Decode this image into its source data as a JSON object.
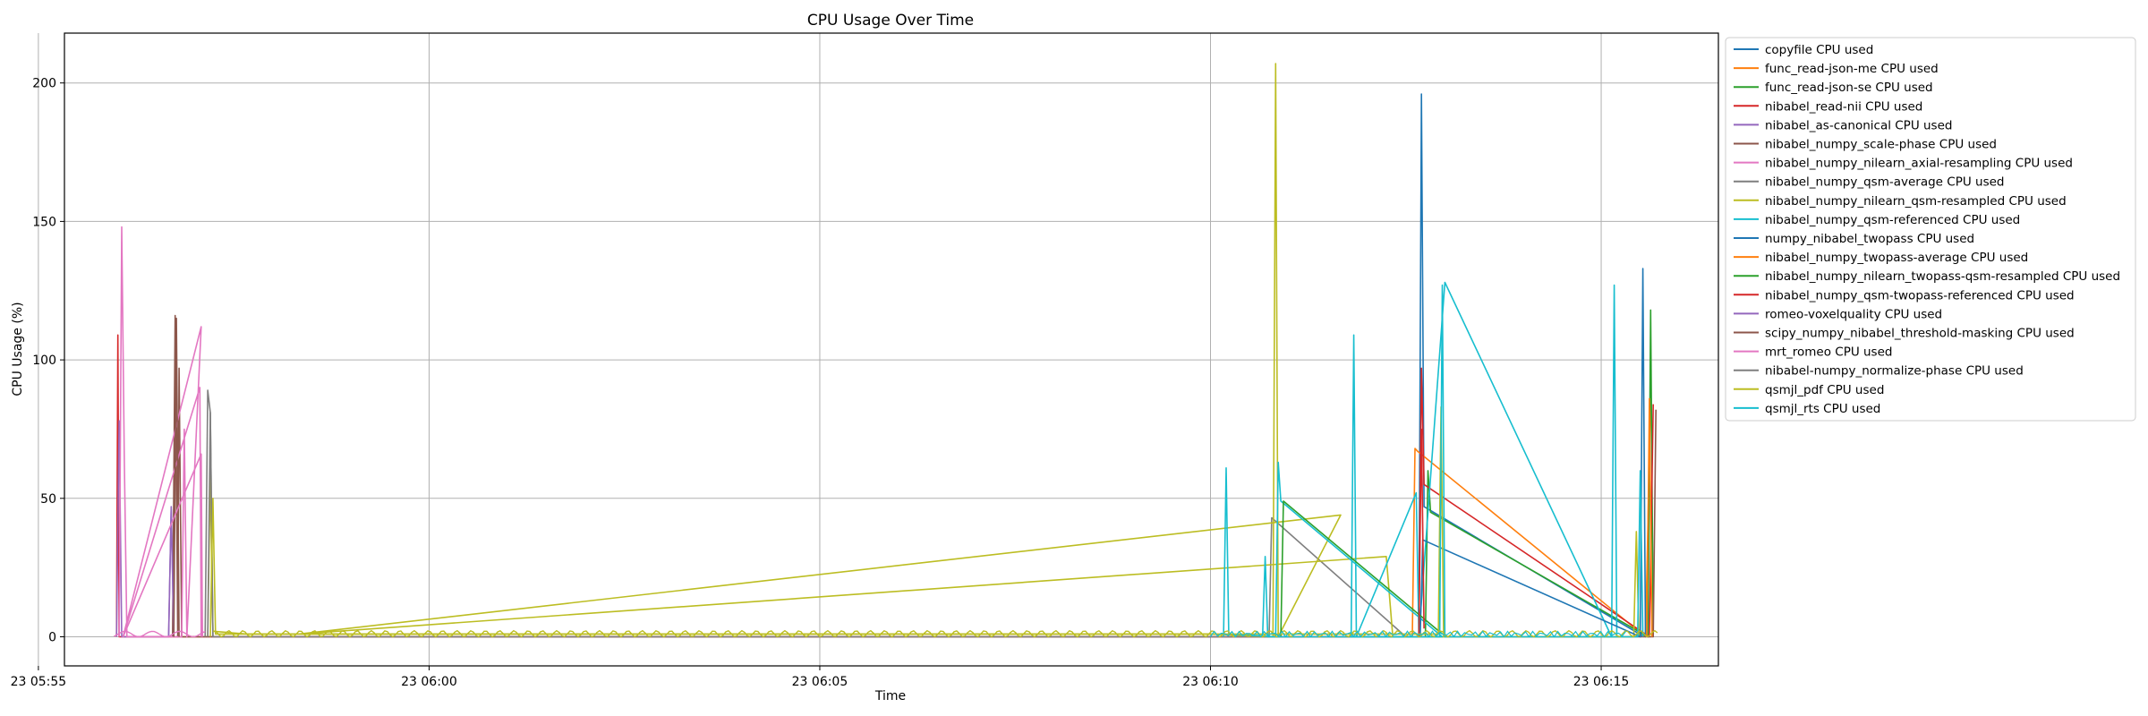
{
  "chart_data": {
    "type": "line",
    "title": "CPU Usage Over Time",
    "xlabel": "Time",
    "ylabel": "CPU Usage (%)",
    "grid": true,
    "legend_placement": "outside-right",
    "x_ticks": [
      "23 05:55",
      "23 06:00",
      "23 06:05",
      "23 06:10",
      "23 06:15"
    ],
    "y_ticks": [
      0,
      50,
      100,
      150,
      200
    ],
    "xlim": [
      "05:55:20",
      "06:16:30"
    ],
    "ylim": [
      -10.5,
      218
    ],
    "series": [
      {
        "name": "copyfile CPU used",
        "color": "#1f77b4",
        "points": [
          [
            "06:12:40",
            0
          ],
          [
            "06:12:42",
            196
          ],
          [
            "06:12:44",
            47
          ],
          [
            "06:15:33",
            0
          ]
        ]
      },
      {
        "name": "func_read-json-me CPU used",
        "color": "#ff7f0e",
        "points": [
          [
            "06:12:35",
            0
          ],
          [
            "06:12:37",
            68
          ],
          [
            "06:12:39",
            67
          ],
          [
            "06:15:34",
            0
          ],
          [
            "06:15:38",
            85
          ]
        ]
      },
      {
        "name": "func_read-json-se CPU used",
        "color": "#2ca02c",
        "points": [
          [
            "06:12:45",
            0
          ],
          [
            "06:12:47",
            60
          ],
          [
            "06:12:49",
            45
          ],
          [
            "06:15:36",
            0
          ],
          [
            "06:15:38",
            118
          ],
          [
            "06:15:40",
            0
          ]
        ]
      },
      {
        "name": "nibabel_read-nii CPU used",
        "color": "#d62728",
        "points": [
          [
            "05:56:00",
            0
          ],
          [
            "05:56:01",
            109
          ],
          [
            "05:56:02",
            0
          ],
          [
            "06:12:40",
            0
          ],
          [
            "06:12:42",
            97
          ],
          [
            "06:12:44",
            55
          ],
          [
            "06:15:37",
            0
          ],
          [
            "06:15:40",
            84
          ]
        ]
      },
      {
        "name": "nibabel_as-canonical CPU used",
        "color": "#9467bd",
        "points": [
          [
            "05:56:00",
            0
          ],
          [
            "05:56:02",
            78
          ],
          [
            "05:56:04",
            0
          ],
          [
            "05:56:40",
            0
          ],
          [
            "05:56:42",
            47
          ],
          [
            "05:56:44",
            0
          ]
        ]
      },
      {
        "name": "nibabel_numpy_scale-phase CPU used",
        "color": "#8c564b",
        "points": [
          [
            "05:56:43",
            0
          ],
          [
            "05:56:45",
            116
          ],
          [
            "05:56:47",
            0
          ],
          [
            "05:56:48",
            97
          ],
          [
            "05:56:50",
            0
          ],
          [
            "06:15:40",
            0
          ],
          [
            "06:15:42",
            82
          ]
        ]
      },
      {
        "name": "nibabel_numpy_nilearn_axial-resampling CPU used",
        "color": "#e377c2",
        "points": [
          [
            "05:56:02",
            0
          ],
          [
            "05:56:04",
            148
          ],
          [
            "05:56:06",
            64
          ],
          [
            "05:56:08",
            0
          ],
          [
            "05:56:50",
            0
          ],
          [
            "05:56:52",
            75
          ],
          [
            "05:56:54",
            0
          ],
          [
            "05:57:05",
            112
          ],
          [
            "05:56:05",
            0
          ],
          [
            "05:57:04",
            90
          ],
          [
            "05:57:05",
            0
          ]
        ]
      },
      {
        "name": "nibabel_numpy_qsm-average CPU used",
        "color": "#7f7f7f",
        "points": [
          [
            "05:57:08",
            0
          ],
          [
            "05:57:10",
            89
          ],
          [
            "05:57:12",
            81
          ],
          [
            "05:57:14",
            0
          ],
          [
            "06:10:45",
            0
          ],
          [
            "06:10:47",
            43
          ],
          [
            "06:12:30",
            0
          ]
        ]
      },
      {
        "name": "nibabel_numpy_nilearn_qsm-resampled CPU used",
        "color": "#bcbd22",
        "points": [
          [
            "05:57:10",
            0
          ],
          [
            "05:57:12",
            58
          ],
          [
            "05:57:14",
            2
          ],
          [
            "05:57:40",
            1
          ],
          [
            "06:00:00",
            1
          ],
          [
            "06:05:00",
            1
          ],
          [
            "06:10:00",
            1
          ],
          [
            "06:10:48",
            0
          ],
          [
            "06:10:50",
            207
          ],
          [
            "06:10:52",
            0
          ],
          [
            "06:11:40",
            44
          ],
          [
            "05:58:20",
            1
          ],
          [
            "06:12:15",
            29
          ],
          [
            "06:12:20",
            0
          ],
          [
            "06:15:25",
            0
          ],
          [
            "06:15:27",
            38
          ],
          [
            "06:15:29",
            0
          ]
        ]
      },
      {
        "name": "nibabel_numpy_qsm-referenced CPU used",
        "color": "#17becf",
        "points": [
          [
            "06:10:10",
            0
          ],
          [
            "06:10:12",
            61
          ],
          [
            "06:10:14",
            1
          ],
          [
            "06:10:50",
            0
          ],
          [
            "06:10:52",
            63
          ],
          [
            "06:10:54",
            49
          ],
          [
            "06:12:58",
            0
          ],
          [
            "06:11:48",
            0
          ],
          [
            "06:11:50",
            109
          ],
          [
            "06:11:52",
            0
          ],
          [
            "06:12:38",
            52
          ],
          [
            "06:12:40",
            0
          ],
          [
            "06:13:00",
            128
          ],
          [
            "06:15:08",
            0
          ],
          [
            "06:15:10",
            127
          ],
          [
            "06:15:12",
            0
          ]
        ]
      },
      {
        "name": "numpy_nibabel_twopass CPU used",
        "color": "#1f77b4",
        "points": [
          [
            "06:12:41",
            0
          ],
          [
            "06:12:43",
            35
          ],
          [
            "06:15:30",
            0
          ],
          [
            "06:15:32",
            133
          ],
          [
            "06:15:34",
            0
          ]
        ]
      },
      {
        "name": "nibabel_numpy_twopass-average CPU used",
        "color": "#ff7f0e",
        "points": [
          [
            "06:15:35",
            0
          ],
          [
            "06:15:37",
            86
          ],
          [
            "06:15:39",
            0
          ]
        ]
      },
      {
        "name": "nibabel_numpy_nilearn_twopass-qsm-resampled CPU used",
        "color": "#2ca02c",
        "points": [
          [
            "06:10:54",
            0
          ],
          [
            "06:10:56",
            49
          ],
          [
            "06:12:58",
            1
          ]
        ]
      },
      {
        "name": "nibabel_numpy_qsm-twopass-referenced CPU used",
        "color": "#d62728",
        "points": [
          [
            "06:12:40",
            0
          ],
          [
            "06:12:42",
            75
          ],
          [
            "06:12:44",
            3
          ]
        ]
      },
      {
        "name": "romeo-voxelquality CPU used",
        "color": "#9467bd",
        "points": [
          [
            "05:56:40",
            0
          ],
          [
            "05:56:42",
            46
          ],
          [
            "05:56:44",
            0
          ]
        ]
      },
      {
        "name": "scipy_numpy_nibabel_threshold-masking CPU used",
        "color": "#8c564b",
        "points": [
          [
            "05:56:44",
            0
          ],
          [
            "05:56:46",
            115
          ],
          [
            "05:56:48",
            0
          ]
        ]
      },
      {
        "name": "mrt_romeo CPU used",
        "color": "#e377c2",
        "points": [
          [
            "05:56:05",
            0
          ],
          [
            "05:57:05",
            66
          ],
          [
            "05:57:06",
            0
          ]
        ]
      },
      {
        "name": "nibabel-numpy_normalize-phase CPU used",
        "color": "#7f7f7f",
        "points": [
          [
            "05:57:10",
            0
          ],
          [
            "05:57:12",
            81
          ],
          [
            "05:57:14",
            0
          ]
        ]
      },
      {
        "name": "qsmjl_pdf CPU used",
        "color": "#bcbd22",
        "points": [
          [
            "05:57:12",
            0
          ],
          [
            "05:57:14",
            50
          ],
          [
            "05:57:16",
            1
          ],
          [
            "06:12:55",
            1
          ],
          [
            "06:12:57",
            83
          ],
          [
            "06:12:59",
            0
          ]
        ]
      },
      {
        "name": "qsmjl_rts CPU used",
        "color": "#17becf",
        "points": [
          [
            "06:10:40",
            0
          ],
          [
            "06:10:42",
            29
          ],
          [
            "06:10:44",
            0
          ],
          [
            "06:12:56",
            0
          ],
          [
            "06:12:58",
            127
          ],
          [
            "06:13:00",
            0
          ],
          [
            "06:15:28",
            0
          ],
          [
            "06:15:30",
            60
          ],
          [
            "06:15:32",
            0
          ]
        ]
      }
    ]
  }
}
